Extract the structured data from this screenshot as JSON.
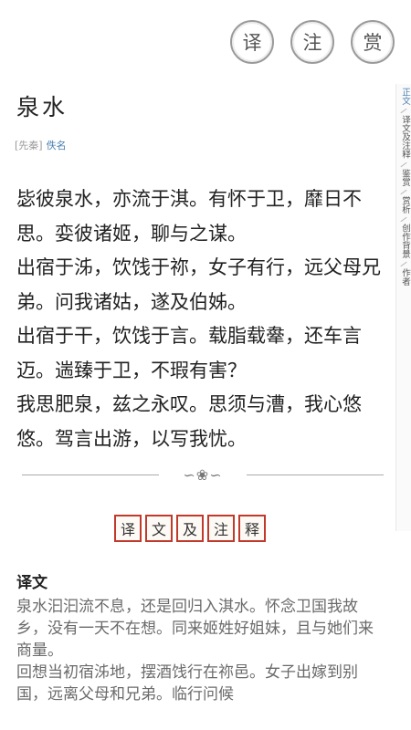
{
  "toolbar": {
    "translate_label": "译",
    "annotate_label": "注",
    "appreciate_label": "赏"
  },
  "poem": {
    "title": "泉水",
    "dynasty": "[先秦]",
    "author": "佚名",
    "lines": [
      "毖彼泉水，亦流于淇。有怀于卫，靡日不思。娈彼诸姬，聊与之谋。",
      "出宿于泲，饮饯于祢，女子有行，远父母兄弟。问我诸姑，遂及伯姊。",
      "出宿于干，饮饯于言。载脂载舝，还车言迈。遄臻于卫，不瑕有害？",
      "我思肥泉，兹之永叹。思须与漕，我心悠悠。驾言出游，以写我忧。"
    ]
  },
  "divider": {
    "ornament": "∽❀∽"
  },
  "section_seal": [
    "译",
    "文",
    "及",
    "注",
    "释"
  ],
  "translation": {
    "heading": "译文",
    "paragraphs": [
      "泉水汩汩流不息，还是回归入淇水。怀念卫国我故乡，没有一天不在想。同来姬姓好姐妹，且与她们来商量。",
      "回想当初宿泲地，摆酒饯行在祢邑。女子出嫁到别国，远离父母和兄弟。临行问候"
    ]
  },
  "sidebar": {
    "items": [
      "正文",
      "译文及注释",
      "鉴赏",
      "赏析",
      "创作背景",
      "作者"
    ]
  }
}
